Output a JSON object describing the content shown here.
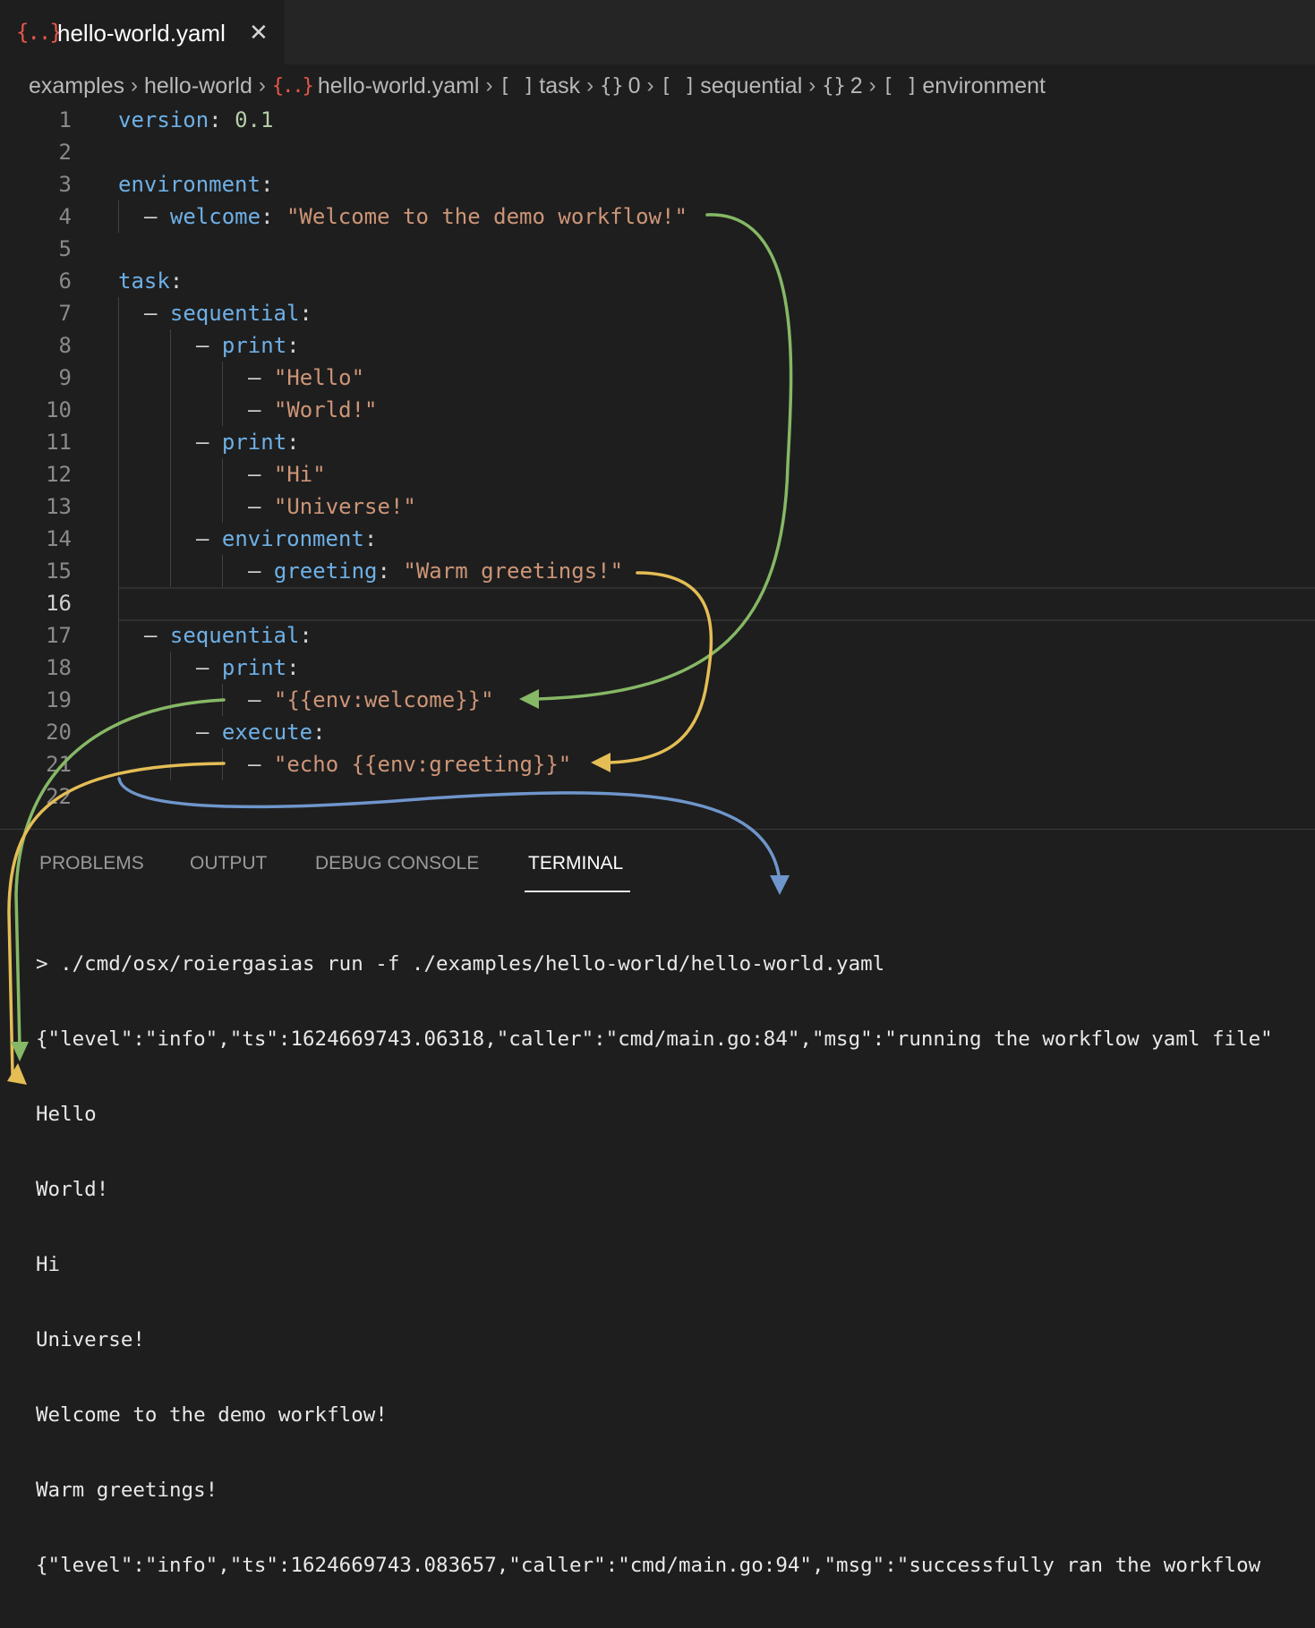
{
  "tab": {
    "icon": "{..}",
    "icon_name": "json-braces-icon",
    "title": "hello-world.yaml",
    "close": "✕"
  },
  "breadcrumb": {
    "folder1": "examples",
    "folder2": "hello-world",
    "file_icon": "{..}",
    "file": "hello-world.yaml",
    "task_sym": "[ ]",
    "task": "task",
    "idx0_sym": "{}",
    "idx0": "0",
    "seq_sym": "[ ]",
    "seq": "sequential",
    "idx2_sym": "{}",
    "idx2": "2",
    "env_sym": "[ ]",
    "env": "environment",
    "sep": "›"
  },
  "editor": {
    "line_numbers": [
      "1",
      "2",
      "3",
      "4",
      "5",
      "6",
      "7",
      "8",
      "9",
      "10",
      "11",
      "12",
      "13",
      "14",
      "15",
      "16",
      "17",
      "18",
      "19",
      "20",
      "21",
      "22"
    ],
    "active_line": "16",
    "t": {
      "version_key": "version",
      "version_val": "0.1",
      "environment_key": "environment",
      "welcome_key": "welcome",
      "welcome_val": "\"Welcome to the demo workflow!\"",
      "task_key": "task",
      "sequential_key": "sequential",
      "print_key": "print",
      "hello": "\"Hello\"",
      "world": "\"World!\"",
      "hi": "\"Hi\"",
      "universe": "\"Universe!\"",
      "greeting_key": "greeting",
      "greeting_val": "\"Warm greetings!\"",
      "env_welcome": "\"{{env:welcome}}\"",
      "execute_key": "execute",
      "echo": "\"echo {{env:greeting}}\"",
      "colon": ":",
      "dash": "– "
    }
  },
  "panel": {
    "tabs": [
      "PROBLEMS",
      "OUTPUT",
      "DEBUG CONSOLE",
      "TERMINAL"
    ],
    "active_tab": "TERMINAL",
    "terminal_lines": [
      "> ./cmd/osx/roiergasias run -f ./examples/hello-world/hello-world.yaml",
      "{\"level\":\"info\",\"ts\":1624669743.06318,\"caller\":\"cmd/main.go:84\",\"msg\":\"running the workflow yaml file\"",
      "Hello",
      "World!",
      "Hi",
      "Universe!",
      "Welcome to the demo workflow!",
      "Warm greetings!",
      "{\"level\":\"info\",\"ts\":1624669743.083657,\"caller\":\"cmd/main.go:94\",\"msg\":\"successfully ran the workflow"
    ]
  },
  "colors": {
    "green_arrow": "#86b865",
    "yellow_arrow": "#e4bd55",
    "blue_arrow": "#6f96cc",
    "key": "#6eb0e6",
    "string": "#cd9577",
    "number": "#b5cea8"
  }
}
